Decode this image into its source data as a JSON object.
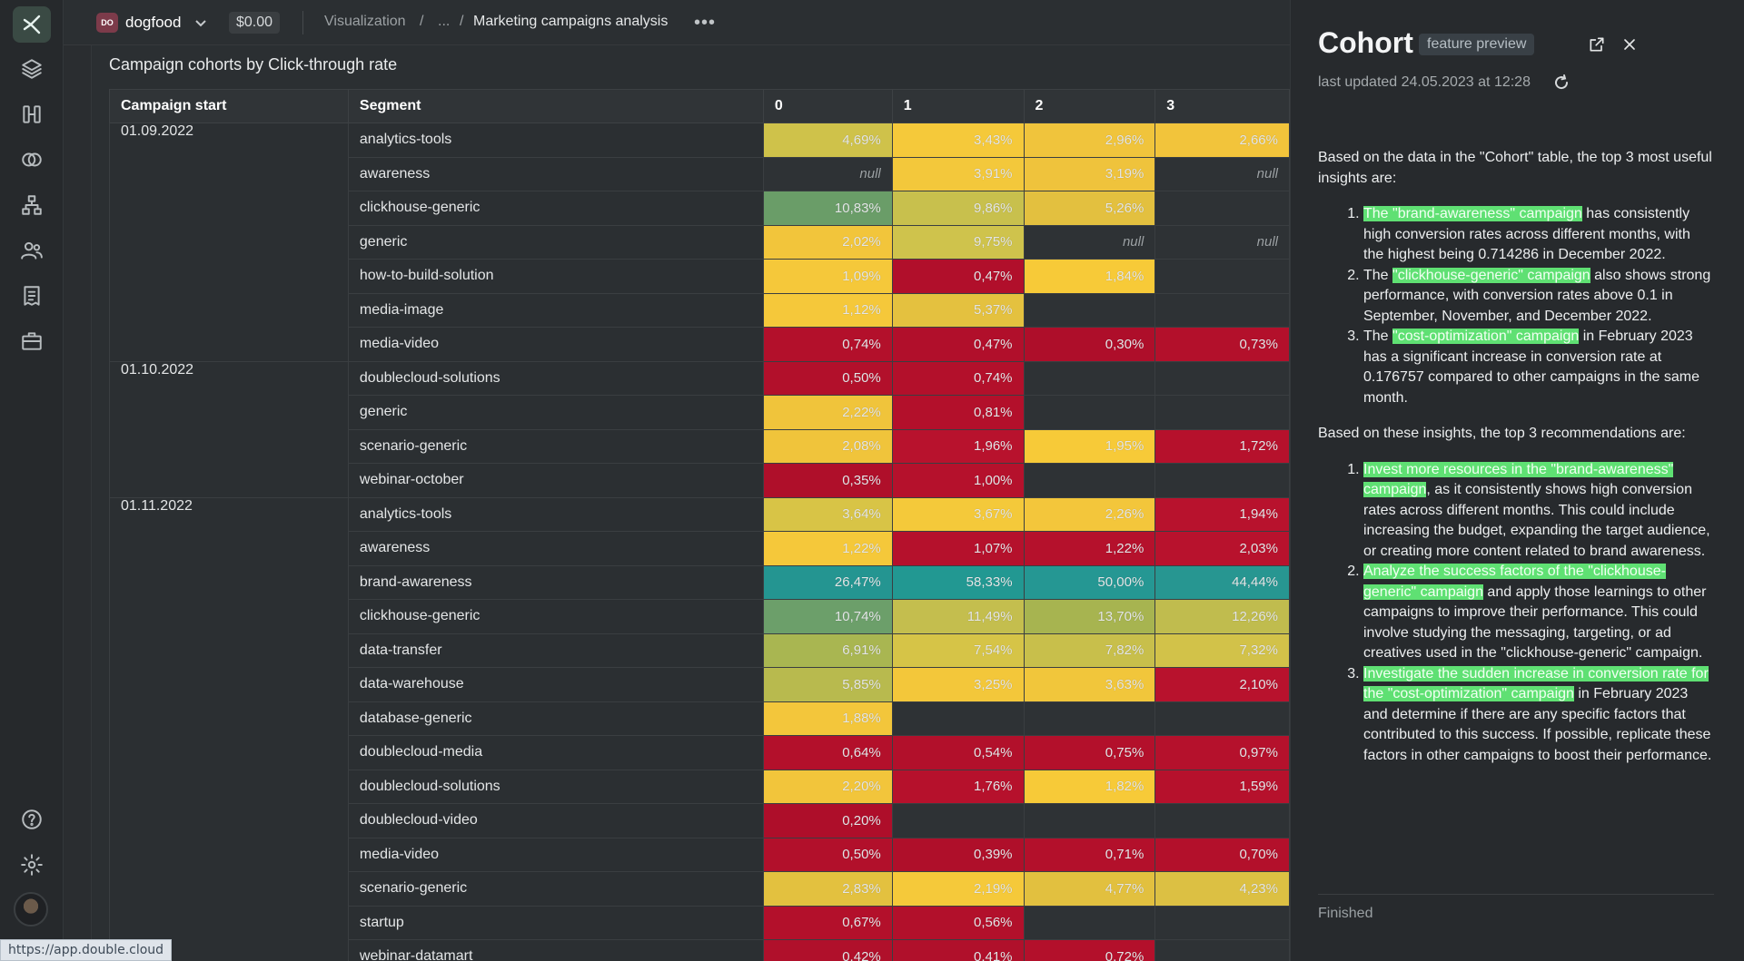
{
  "topbar": {
    "workspace_badge": "DO",
    "workspace_name": "dogfood",
    "price": "$0.00",
    "breadcrumb_1": "Visualization",
    "breadcrumb_sep": "/",
    "breadcrumb_2": "...",
    "breadcrumb_current": "Marketing campaigns analysis",
    "more": "•••"
  },
  "chart": {
    "title": "Campaign cohorts by Click-through rate",
    "headers": [
      "Campaign start",
      "Segment",
      "0",
      "1",
      "2",
      "3"
    ],
    "colors": {
      "dark_red": "#b5102b",
      "yellow": "#f5c638",
      "olive": "#c8bf4e",
      "green": "#6aa06b",
      "teal": "#249692",
      "null": "#2e3235"
    },
    "groups": [
      {
        "date": "01.09.2022",
        "rows": [
          {
            "segment": "analytics-tools",
            "cells": [
              [
                "4,69%",
                "#cfc24a"
              ],
              [
                "3,43%",
                "#f5c93a"
              ],
              [
                "2,96%",
                "#f0c43c"
              ],
              [
                "2,66%",
                "#f2c43b"
              ]
            ]
          },
          {
            "segment": "awareness",
            "cells": [
              [
                "null",
                "null"
              ],
              [
                "3,91%",
                "#f3c83b"
              ],
              [
                "3,19%",
                "#efc33c"
              ],
              [
                "null",
                "null"
              ]
            ]
          },
          {
            "segment": "clickhouse-generic",
            "cells": [
              [
                "10,83%",
                "#6a9d68"
              ],
              [
                "9,86%",
                "#c8c04d"
              ],
              [
                "5,26%",
                "#e3c03f"
              ],
              [
                "",
                ""
              ]
            ]
          },
          {
            "segment": "generic",
            "cells": [
              [
                "2,02%",
                "#f2c53b"
              ],
              [
                "9,75%",
                "#cfc34c"
              ],
              [
                "null",
                "null"
              ],
              [
                "null",
                "null"
              ]
            ]
          },
          {
            "segment": "how-to-build-solution",
            "cells": [
              [
                "1,09%",
                "#f5c83a"
              ],
              [
                "0,47%",
                "#b10f2b"
              ],
              [
                "1,84%",
                "#f7ca38"
              ],
              [
                "",
                ""
              ]
            ]
          },
          {
            "segment": "media-image",
            "cells": [
              [
                "1,12%",
                "#f5c83a"
              ],
              [
                "5,37%",
                "#e4c13f"
              ],
              [
                "",
                ""
              ],
              [
                "",
                ""
              ]
            ]
          },
          {
            "segment": "media-video",
            "cells": [
              [
                "0,74%",
                "#b3102b"
              ],
              [
                "0,47%",
                "#b10f2b"
              ],
              [
                "0,30%",
                "#ae0e2a"
              ],
              [
                "0,73%",
                "#b3102b"
              ]
            ]
          }
        ]
      },
      {
        "date": "01.10.2022",
        "rows": [
          {
            "segment": "doublecloud-solutions",
            "cells": [
              [
                "0,50%",
                "#b2102b"
              ],
              [
                "0,74%",
                "#b3102b"
              ],
              [
                "",
                ""
              ],
              [
                "",
                ""
              ]
            ]
          },
          {
            "segment": "generic",
            "cells": [
              [
                "2,22%",
                "#f0c43b"
              ],
              [
                "0,81%",
                "#b3102b"
              ],
              [
                "",
                ""
              ],
              [
                "",
                ""
              ]
            ]
          },
          {
            "segment": "scenario-generic",
            "cells": [
              [
                "2,08%",
                "#f0c43b"
              ],
              [
                "1,96%",
                "#b8122d"
              ],
              [
                "1,95%",
                "#f7ca38"
              ],
              [
                "1,72%",
                "#b6112c"
              ]
            ]
          },
          {
            "segment": "webinar-october",
            "cells": [
              [
                "0,35%",
                "#af0f2a"
              ],
              [
                "1,00%",
                "#b5112c"
              ],
              [
                "",
                ""
              ],
              [
                "",
                ""
              ]
            ]
          }
        ]
      },
      {
        "date": "01.11.2022",
        "rows": [
          {
            "segment": "analytics-tools",
            "cells": [
              [
                "3,64%",
                "#d8c446"
              ],
              [
                "3,67%",
                "#f4c93a"
              ],
              [
                "2,26%",
                "#f3c63b"
              ],
              [
                "1,94%",
                "#b8122d"
              ]
            ]
          },
          {
            "segment": "awareness",
            "cells": [
              [
                "1,22%",
                "#f5c83a"
              ],
              [
                "1,07%",
                "#b5112c"
              ],
              [
                "1,22%",
                "#b5112c"
              ],
              [
                "2,03%",
                "#b8122d"
              ]
            ]
          },
          {
            "segment": "brand-awareness",
            "cells": [
              [
                "26,47%",
                "#249591"
              ],
              [
                "58,33%",
                "#229892"
              ],
              [
                "50,00%",
                "#259793"
              ],
              [
                "44,44%",
                "#279691"
              ]
            ]
          },
          {
            "segment": "clickhouse-generic",
            "cells": [
              [
                "10,74%",
                "#6c9f6a"
              ],
              [
                "11,49%",
                "#c4be4e"
              ],
              [
                "13,70%",
                "#a7b450"
              ],
              [
                "12,26%",
                "#c0bc4e"
              ]
            ]
          },
          {
            "segment": "data-transfer",
            "cells": [
              [
                "6,91%",
                "#a9b651"
              ],
              [
                "7,54%",
                "#d6c447"
              ],
              [
                "7,82%",
                "#c8bf4b"
              ],
              [
                "7,32%",
                "#d2c249"
              ]
            ]
          },
          {
            "segment": "data-warehouse",
            "cells": [
              [
                "5,85%",
                "#b8ba4e"
              ],
              [
                "3,25%",
                "#f3c73a"
              ],
              [
                "3,63%",
                "#f1c63b"
              ],
              [
                "2,10%",
                "#b8122d"
              ]
            ]
          },
          {
            "segment": "database-generic",
            "cells": [
              [
                "1,88%",
                "#f3c63b"
              ],
              [
                "",
                ""
              ],
              [
                "",
                ""
              ],
              [
                "",
                ""
              ]
            ]
          },
          {
            "segment": "doublecloud-media",
            "cells": [
              [
                "0,64%",
                "#b3102b"
              ],
              [
                "0,54%",
                "#b2102b"
              ],
              [
                "0,75%",
                "#b3102b"
              ],
              [
                "0,97%",
                "#b5112c"
              ]
            ]
          },
          {
            "segment": "doublecloud-solutions",
            "cells": [
              [
                "2,20%",
                "#f2c53b"
              ],
              [
                "1,76%",
                "#b6112c"
              ],
              [
                "1,82%",
                "#f7ca38"
              ],
              [
                "1,59%",
                "#b6112c"
              ]
            ]
          },
          {
            "segment": "doublecloud-video",
            "cells": [
              [
                "0,20%",
                "#ae0e2a"
              ],
              [
                "",
                ""
              ],
              [
                "",
                ""
              ],
              [
                "",
                ""
              ]
            ]
          },
          {
            "segment": "media-video",
            "cells": [
              [
                "0,50%",
                "#b2102b"
              ],
              [
                "0,39%",
                "#af0f2a"
              ],
              [
                "0,71%",
                "#b3102b"
              ],
              [
                "0,70%",
                "#b3102b"
              ]
            ]
          },
          {
            "segment": "scenario-generic",
            "cells": [
              [
                "2,83%",
                "#e3c13f"
              ],
              [
                "2,19%",
                "#f5c93a"
              ],
              [
                "4,77%",
                "#e2c03f"
              ],
              [
                "4,23%",
                "#dcc043"
              ]
            ]
          },
          {
            "segment": "startup",
            "cells": [
              [
                "0,67%",
                "#b3102b"
              ],
              [
                "0,56%",
                "#b2102b"
              ],
              [
                "",
                ""
              ],
              [
                "",
                ""
              ]
            ]
          },
          {
            "segment": "webinar-datamart",
            "cells": [
              [
                "0,42%",
                "#b0102b"
              ],
              [
                "0,41%",
                "#b0102b"
              ],
              [
                "0,72%",
                "#b3102b"
              ],
              [
                "",
                ""
              ]
            ]
          }
        ]
      }
    ]
  },
  "panel": {
    "title": "Cohort",
    "badge": "feature preview",
    "updated": "last updated 24.05.2023 at 12:28",
    "intro": "Based on the data in the \"Cohort\" table, the top 3 most useful insights are:",
    "insights": [
      {
        "hl": "The \"brand-awareness\" campaign",
        "rest": " has consistently high conversion rates across different months, with the highest being 0.714286 in December 2022."
      },
      {
        "pre": "The ",
        "hl": "\"clickhouse-generic\" campaign",
        "rest": " also shows strong performance, with conversion rates above 0.1 in September, November, and December 2022."
      },
      {
        "pre": "The ",
        "hl": "\"cost-optimization\" campaign",
        "rest": " in February 2023 has a significant increase in conversion rate at 0.176757 compared to other campaigns in the same month."
      }
    ],
    "recs_intro": "Based on these insights, the top 3 recommendations are:",
    "recs": [
      {
        "hl": "Invest more resources in the \"brand-awareness\" campaign",
        "rest": ", as it consistently shows high conversion rates across different months. This could include increasing the budget, expanding the target audience, or creating more content related to brand awareness."
      },
      {
        "hl": "Analyze the success factors of the \"clickhouse-generic\" campaign",
        "rest": " and apply those learnings to other campaigns to improve their performance. This could involve studying the messaging, targeting, or ad creatives used in the \"clickhouse-generic\" campaign."
      },
      {
        "hl": "Investigate the sudden increase in conversion rate for the \"cost-optimization\" campaign",
        "rest": " in February 2023 and determine if there are any specific factors that contributed to this success. If possible, replicate these factors in other campaigns to boost their performance."
      }
    ],
    "status": "Finished"
  },
  "status_url": "https://app.double.cloud"
}
